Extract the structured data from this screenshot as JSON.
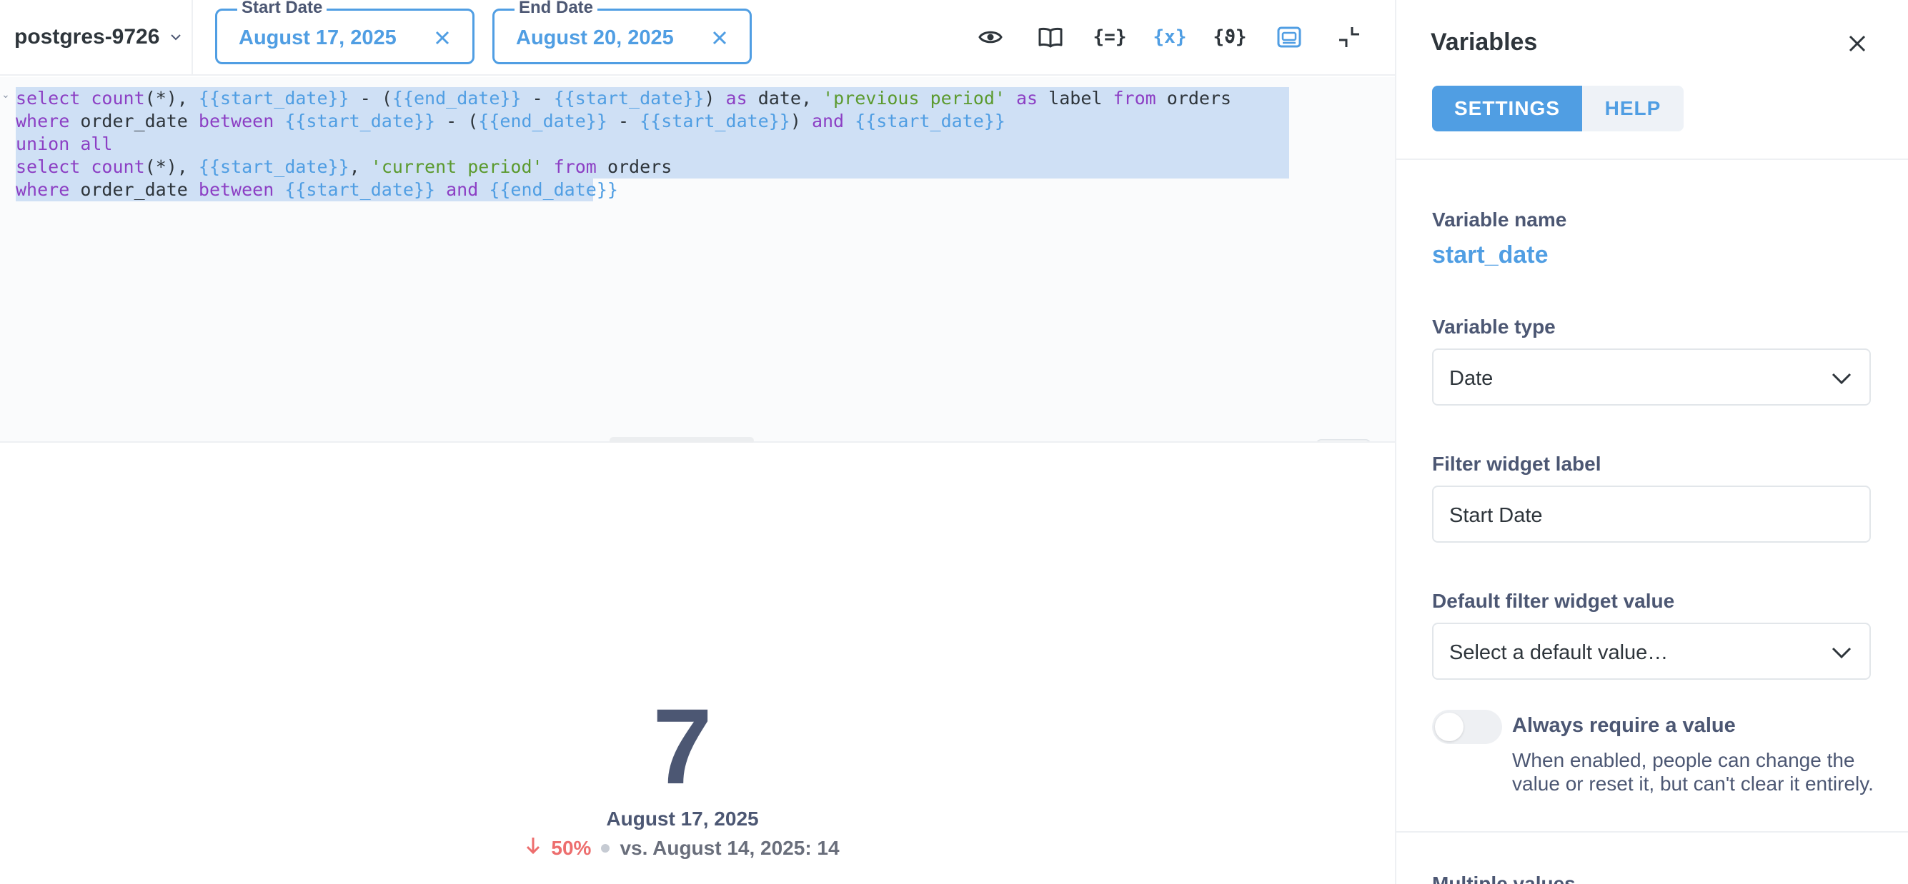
{
  "topbar": {
    "database": "postgres-9726",
    "start_filter": {
      "legend": "Start Date",
      "value": "August 17, 2025"
    },
    "end_filter": {
      "legend": "End Date",
      "value": "August 20, 2025"
    },
    "icons": [
      "eye-icon",
      "book-icon",
      "snippet-icon",
      "variables-icon",
      "template-icon",
      "preview-icon",
      "collapse-icon"
    ],
    "icon_glyphs": {
      "snippet": "{=}",
      "variables": "{x}",
      "template": "{ϑ}"
    }
  },
  "editor": {
    "lines": [
      "select count(*), {{start_date}} - ({{end_date}} - {{start_date}}) as date, 'previous period' as label from orders",
      "where order_date between {{start_date}} - ({{end_date}} - {{start_date}}) and {{start_date}}",
      "union all",
      "select count(*), {{start_date}}, 'current period' from orders",
      "where order_date between {{start_date}} and {{end_date}}"
    ]
  },
  "result": {
    "value": "7",
    "date": "August 17, 2025",
    "change_percent": "50%",
    "comparison": "vs. August 14, 2025: 14"
  },
  "sidebar": {
    "title": "Variables",
    "tabs": {
      "settings": "SETTINGS",
      "help": "HELP"
    },
    "variable_name_label": "Variable name",
    "variable_name": "start_date",
    "variable_type_label": "Variable type",
    "variable_type": "Date",
    "widget_label_label": "Filter widget label",
    "widget_label_value": "Start Date",
    "default_label": "Default filter widget value",
    "default_placeholder": "Select a default value…",
    "require_label": "Always require a value",
    "require_desc": "When enabled, people can change the value or reset it, but can't clear it entirely.",
    "cut_label": "Multiple values"
  },
  "colors": {
    "brand": "#509ee3",
    "text": "#4c5773",
    "negative": "#ed6e6e",
    "selection": "#cfe0f5"
  }
}
